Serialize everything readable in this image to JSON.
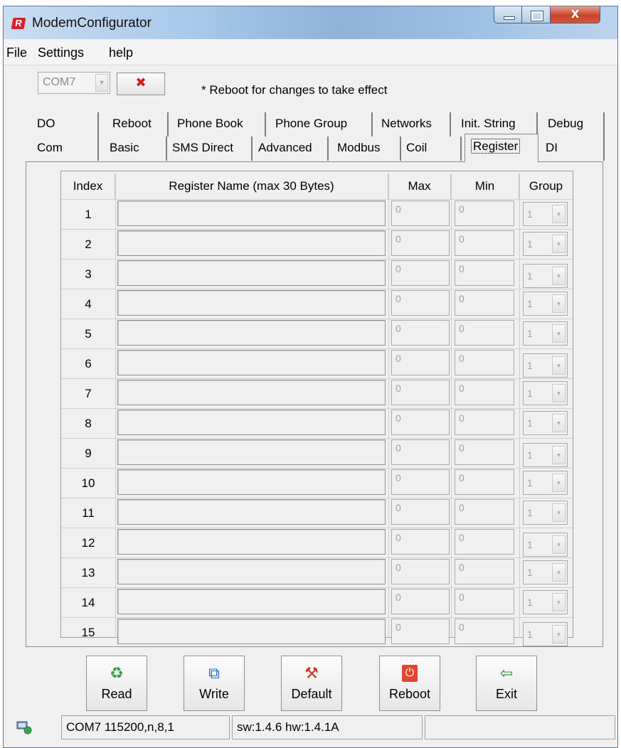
{
  "window": {
    "title": "ModemConfigurator",
    "app_icon_letter": "R",
    "buttons": {
      "minimize_icon": "minimize-icon",
      "maximize_icon": "maximize-icon",
      "close_glyph": "X"
    }
  },
  "menu": {
    "items": [
      "File",
      "Settings",
      "help"
    ]
  },
  "toolbar": {
    "port_select": {
      "value": "COM7",
      "arrow": "▾"
    },
    "close_port_glyph": "✖",
    "notice": "* Reboot for changes to take effect"
  },
  "tabs": {
    "row1": [
      "DO",
      "Reboot",
      "Phone Book",
      "Phone Group",
      "Networks",
      "Init. String",
      "Debug"
    ],
    "row2": [
      "Com",
      "Basic",
      "SMS Direct",
      "Advanced",
      "Modbus",
      "Coil",
      "Register",
      "DI"
    ],
    "active": "Register"
  },
  "table": {
    "headers": [
      "Index",
      "Register Name (max 30 Bytes)",
      "Max",
      "Min",
      "Group"
    ],
    "rows": [
      {
        "index": "1",
        "name": "",
        "max": "0",
        "min": "0",
        "group": "1"
      },
      {
        "index": "2",
        "name": "",
        "max": "0",
        "min": "0",
        "group": "1"
      },
      {
        "index": "3",
        "name": "",
        "max": "0",
        "min": "0",
        "group": "1"
      },
      {
        "index": "4",
        "name": "",
        "max": "0",
        "min": "0",
        "group": "1"
      },
      {
        "index": "5",
        "name": "",
        "max": "0",
        "min": "0",
        "group": "1"
      },
      {
        "index": "6",
        "name": "",
        "max": "0",
        "min": "0",
        "group": "1"
      },
      {
        "index": "7",
        "name": "",
        "max": "0",
        "min": "0",
        "group": "1"
      },
      {
        "index": "8",
        "name": "",
        "max": "0",
        "min": "0",
        "group": "1"
      },
      {
        "index": "9",
        "name": "",
        "max": "0",
        "min": "0",
        "group": "1"
      },
      {
        "index": "10",
        "name": "",
        "max": "0",
        "min": "0",
        "group": "1"
      },
      {
        "index": "11",
        "name": "",
        "max": "0",
        "min": "0",
        "group": "1"
      },
      {
        "index": "12",
        "name": "",
        "max": "0",
        "min": "0",
        "group": "1"
      },
      {
        "index": "13",
        "name": "",
        "max": "0",
        "min": "0",
        "group": "1"
      },
      {
        "index": "14",
        "name": "",
        "max": "0",
        "min": "0",
        "group": "1"
      },
      {
        "index": "15",
        "name": "",
        "max": "0",
        "min": "0",
        "group": "1"
      }
    ],
    "dropdown_arrow": "▾"
  },
  "actions": [
    {
      "label": "Read",
      "icon": "recycle-icon",
      "glyph": "♻",
      "color": "#2f9e3a"
    },
    {
      "label": "Write",
      "icon": "write-icon",
      "glyph": "⧉",
      "color": "#1f66c9"
    },
    {
      "label": "Default",
      "icon": "tools-icon",
      "glyph": "⚒",
      "color": "#c0392b"
    },
    {
      "label": "Reboot",
      "icon": "power-icon",
      "glyph": "⏻",
      "color": "#e2452f"
    },
    {
      "label": "Exit",
      "icon": "exit-door-icon",
      "glyph": "⇦",
      "color": "#2a8a3a"
    }
  ],
  "status": {
    "icon": "network-icon",
    "port_info": "COM7 115200,n,8,1",
    "versions": "sw:1.4.6 hw:1.4.1A",
    "extra": ""
  }
}
